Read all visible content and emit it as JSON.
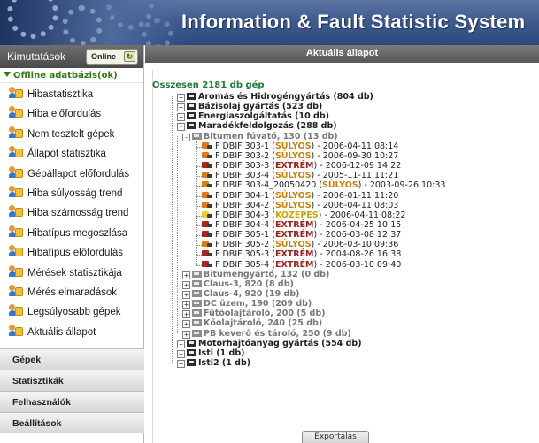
{
  "header": {
    "title": "Information & Fault Statistic System"
  },
  "sidebar": {
    "title": "Kimutatások",
    "online_label": "Online",
    "offline_label": "Offline adatbázis(ok)",
    "items": [
      "Hibastatisztika",
      "Hiba előfordulás",
      "Nem tesztelt gépek",
      "Állapot statisztika",
      "Gépállapot előfordulás",
      "Hiba súlyosság trend",
      "Hiba számosság trend",
      "Hibatípus megoszlása",
      "Hibatípus előfordulás",
      "Mérések statisztikája",
      "Mérés elmaradások",
      "Legsúlyosabb gépek",
      "Aktuális állapot"
    ],
    "sections": [
      "Gépek",
      "Statisztikák",
      "Felhasználók",
      "Beállítások"
    ]
  },
  "main": {
    "title": "Aktuális állapot",
    "summary": "Összesen 2181 db gép",
    "export_label": "Exportálás"
  },
  "tree": {
    "top_groups": [
      "Aromás és Hidrogéngyártás (804 db)",
      "Bázisolaj gyártás (523 db)",
      "Energiaszolgáltatás (10 db)",
      "Maradékfeldolgozás (288 db)"
    ],
    "sub_group_open": "Bitumen fúvató, 130 (13 db)",
    "leaves": [
      {
        "name": "F DBIF 303-1",
        "severity": "SÚLYOS",
        "level": "sulyos",
        "date": "2006-04-11 08:14"
      },
      {
        "name": "F DBIF 303-2",
        "severity": "SÚLYOS",
        "level": "sulyos",
        "date": "2006-09-30 10:27"
      },
      {
        "name": "F DBIF 303-3",
        "severity": "EXTRÉM",
        "level": "extrem",
        "date": "2006-12-09 14:22"
      },
      {
        "name": "F DBIF 303-4",
        "severity": "SÚLYOS",
        "level": "sulyos",
        "date": "2005-11-11 11:21"
      },
      {
        "name": "F DBIF 303-4_20050420",
        "severity": "SÚLYOS",
        "level": "sulyos",
        "date": "2003-09-26 10:33"
      },
      {
        "name": "F DBIF 304-1",
        "severity": "SÚLYOS",
        "level": "sulyos",
        "date": "2006-01-11 11:20"
      },
      {
        "name": "F DBIF 304-2",
        "severity": "SÚLYOS",
        "level": "sulyos",
        "date": "2006-04-11 08:03"
      },
      {
        "name": "F DBIF 304-3",
        "severity": "KÖZEPES",
        "level": "kozepes",
        "date": "2006-04-11 08:22"
      },
      {
        "name": "F DBIF 304-4",
        "severity": "EXTRÉM",
        "level": "extrem",
        "date": "2006-04-25 10:15"
      },
      {
        "name": "F DBIF 305-1",
        "severity": "EXTRÉM",
        "level": "extrem",
        "date": "2006-03-08 12:37"
      },
      {
        "name": "F DBIF 305-2",
        "severity": "SÚLYOS",
        "level": "sulyos",
        "date": "2006-03-10 09:36"
      },
      {
        "name": "F DBIF 305-3",
        "severity": "EXTRÉM",
        "level": "extrem",
        "date": "2004-08-26 16:38"
      },
      {
        "name": "F DBIF 305-4",
        "severity": "EXTRÉM",
        "level": "extrem",
        "date": "2006-03-10 09:40"
      }
    ],
    "sub_groups": [
      "Bitumengyártó, 132 (0 db)",
      "Claus-3, 820 (8 db)",
      "Claus-4, 920 (19 db)",
      "DC üzem, 190 (209 db)",
      "Fűtőolajtároló, 200 (5 db)",
      "Kőolajtároló, 240 (25 db)",
      "PB keverő és tároló, 250 (9 db)"
    ],
    "bottom_groups": [
      "Motorhajtóanyag gyártás (554 db)",
      "Isti (1 db)",
      "Isti2 (1 db)"
    ]
  },
  "colors": {
    "sulyos": "#c9820a",
    "extrem": "#9b1f1a",
    "kozepes": "#c7a90b",
    "offline": "#2e7a14",
    "summary": "#1f7a3a"
  }
}
